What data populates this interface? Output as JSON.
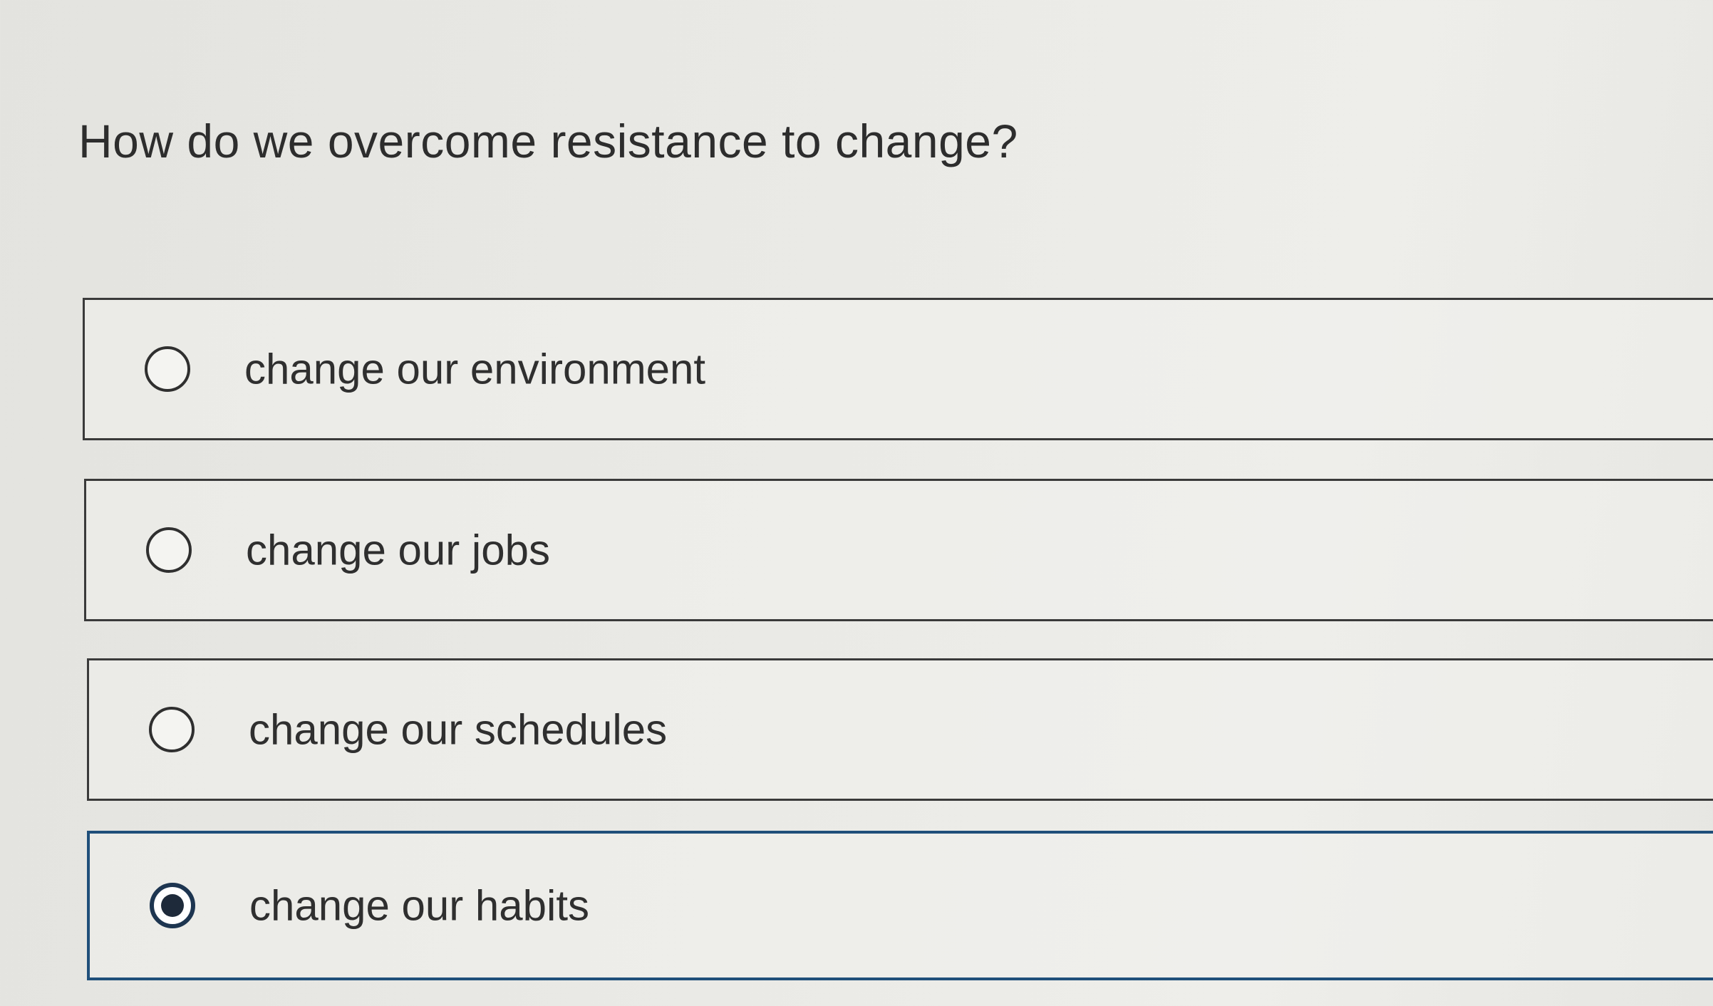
{
  "question": {
    "text": "How do we overcome resistance to change?"
  },
  "options": [
    {
      "label": "change our environment",
      "selected": false
    },
    {
      "label": "change our jobs",
      "selected": false
    },
    {
      "label": "change our schedules",
      "selected": false
    },
    {
      "label": "change our habits",
      "selected": true
    }
  ],
  "colors": {
    "selected_border": "#1f4f7a",
    "radio_fill": "#1e2a3a",
    "text": "#2f2f2f",
    "background": "#e9e9e5"
  }
}
